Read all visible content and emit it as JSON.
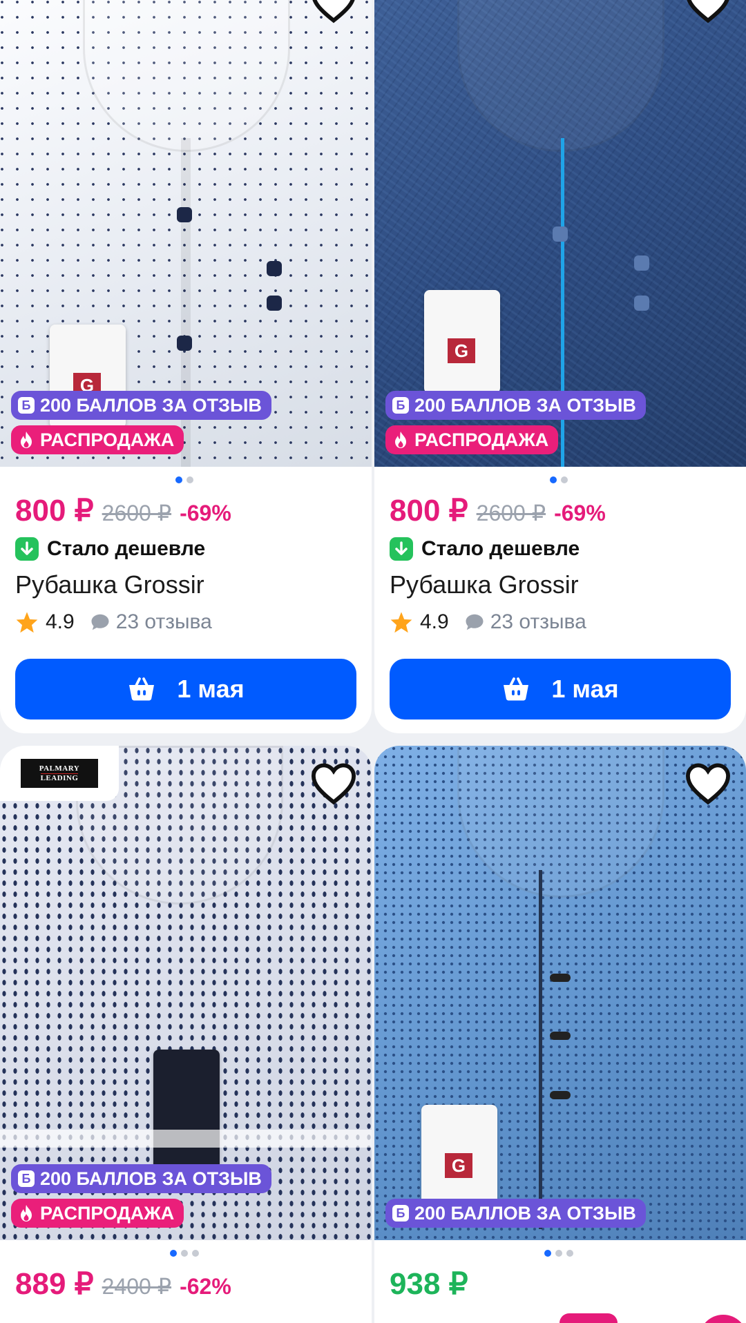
{
  "points_badge": {
    "icon": "Б",
    "label": "200 БАЛЛОВ ЗА ОТЗЫВ"
  },
  "sale_badge": {
    "label": "РАСПРОДАЖА"
  },
  "colors": {
    "accent": "#005bff",
    "price": "#e51b7a",
    "green": "#1db45a",
    "points": "#6b54d8",
    "sale": "#ea1f7a"
  },
  "products": [
    {
      "price": "800 ₽",
      "old_price": "2600 ₽",
      "discount": "-69%",
      "cheaper": "Стало дешевле",
      "title": "Рубашка Grossir",
      "rating": "4.9",
      "reviews": "23 отзыва",
      "cart_label": "1 мая",
      "photo_count": 2,
      "photo_index": 1
    },
    {
      "price": "800 ₽",
      "old_price": "2600 ₽",
      "discount": "-69%",
      "cheaper": "Стало дешевле",
      "title": "Рубашка Grossir",
      "rating": "4.9",
      "reviews": "23 отзыва",
      "cart_label": "1 мая",
      "photo_count": 2,
      "photo_index": 1
    },
    {
      "price": "889 ₽",
      "old_price": "2400 ₽",
      "discount": "-62%",
      "brand_logo": "PALMARY LEADING",
      "photo_count": 3,
      "photo_index": 1
    },
    {
      "price": "938 ₽",
      "photo_count": 3,
      "photo_index": 1
    }
  ]
}
